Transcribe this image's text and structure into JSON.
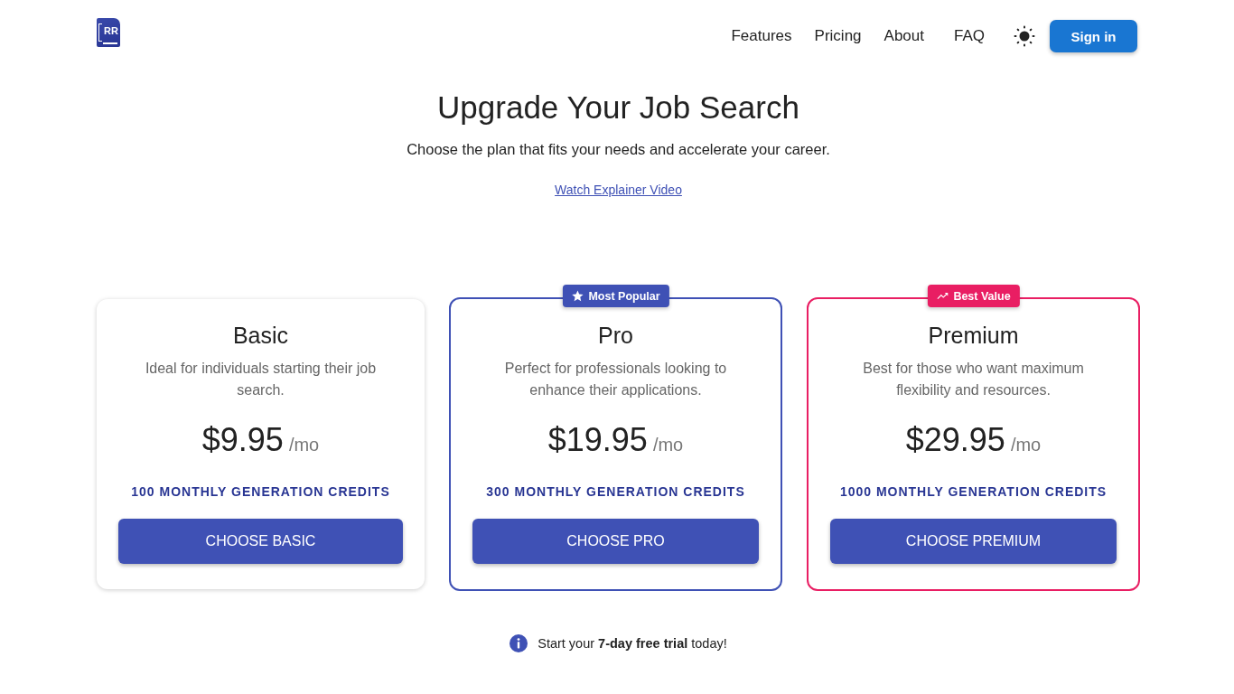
{
  "header": {
    "logo_text": "RR",
    "nav": [
      "Features",
      "Pricing",
      "About",
      "FAQ"
    ],
    "sign_in": "Sign in"
  },
  "hero": {
    "title": "Upgrade Your Job Search",
    "subtitle": "Choose the plan that fits your needs and accelerate your career.",
    "video_link": "Watch Explainer Video"
  },
  "plans": [
    {
      "name": "Basic",
      "description": "Ideal for individuals starting their job search.",
      "price": "$9.95",
      "period": "/mo",
      "credits": "100 MONTHLY GENERATION CREDITS",
      "button": "CHOOSE BASIC"
    },
    {
      "name": "Pro",
      "description": "Perfect for professionals looking to enhance their applications.",
      "price": "$19.95",
      "period": "/mo",
      "credits": "300 MONTHLY GENERATION CREDITS",
      "button": "CHOOSE PRO",
      "badge": {
        "kind": "star",
        "label": "Most Popular",
        "color": "#3f51b5"
      }
    },
    {
      "name": "Premium",
      "description": "Best for those who want maximum flexibility and resources.",
      "price": "$29.95",
      "period": "/mo",
      "credits": "1000 MONTHLY GENERATION CREDITS",
      "button": "CHOOSE PREMIUM",
      "badge": {
        "kind": "trend",
        "label": "Best Value",
        "color": "#e91e63"
      }
    }
  ],
  "trial_note": "Start your **7-day free trial** today!"
}
